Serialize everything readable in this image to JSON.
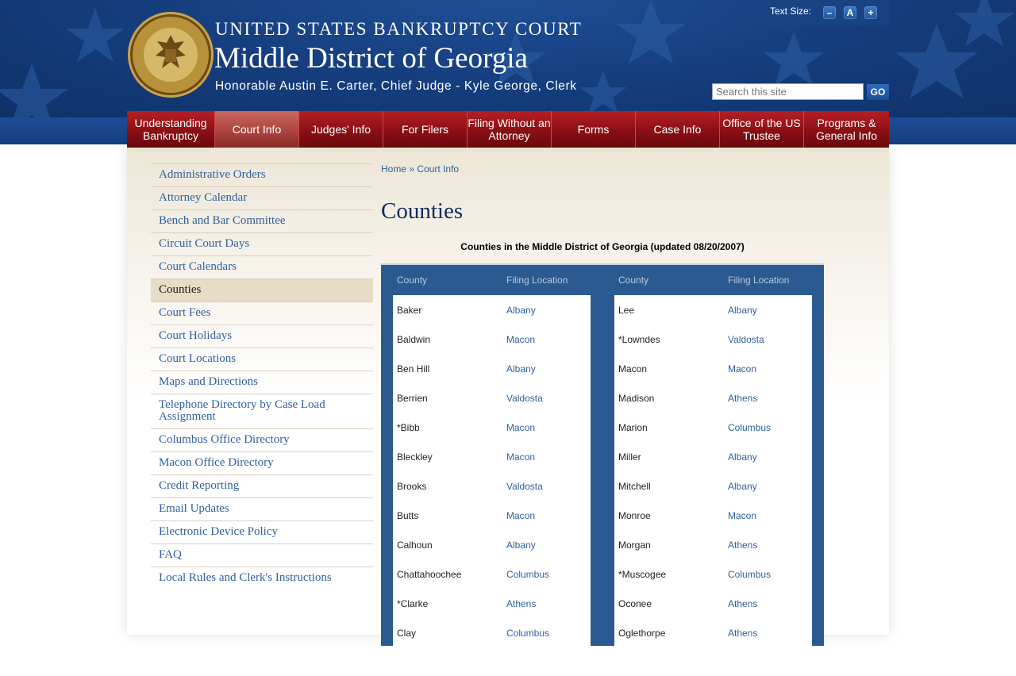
{
  "header": {
    "line1": "UNITED STATES BANKRUPTCY COURT",
    "line2": "Middle District of Georgia",
    "line3": "Honorable Austin E. Carter, Chief Judge - Kyle George, Clerk",
    "seal_text_top": "UNITED STATES BANKRUPTCY COURT",
    "seal_text_bottom": "MIDDLE DISTRICT OF GEORGIA"
  },
  "text_size": {
    "label": "Text Size:",
    "decrease": "–",
    "reset": "A",
    "increase": "+"
  },
  "search": {
    "placeholder": "Search this site",
    "go_label": "GO"
  },
  "nav": [
    {
      "label": "Understanding Bankruptcy",
      "active": false
    },
    {
      "label": "Court Info",
      "active": true
    },
    {
      "label": "Judges' Info",
      "active": false
    },
    {
      "label": "For Filers",
      "active": false
    },
    {
      "label": "Filing Without an Attorney",
      "active": false
    },
    {
      "label": "Forms",
      "active": false
    },
    {
      "label": "Case Info",
      "active": false
    },
    {
      "label": "Office of the US Trustee",
      "active": false
    },
    {
      "label": "Programs & General Info",
      "active": false
    }
  ],
  "sidebar": [
    "Administrative Orders",
    "Attorney Calendar",
    "Bench and Bar Committee",
    "Circuit Court Days",
    "Court Calendars",
    "Counties",
    "Court Fees",
    "Court Holidays",
    "Court Locations",
    "Maps and Directions",
    "Telephone Directory by Case Load Assignment",
    "Columbus Office Directory",
    "Macon Office Directory",
    "Credit Reporting",
    "Email Updates",
    "Electronic Device Policy",
    "FAQ",
    "Local Rules and Clerk's Instructions"
  ],
  "sidebar_active": "Counties",
  "breadcrumb": {
    "home": "Home",
    "sep": "»",
    "current": "Court Info"
  },
  "page_title": "Counties",
  "table_caption": "Counties in the Middle District of Georgia (updated 08/20/2007)",
  "table_headers": {
    "county": "County",
    "location": "Filing Location"
  },
  "counties_left": [
    [
      "Baker",
      "Albany"
    ],
    [
      "Baldwin",
      "Macon"
    ],
    [
      "Ben Hill",
      "Albany"
    ],
    [
      "Berrien",
      "Valdosta"
    ],
    [
      "*Bibb",
      "Macon"
    ],
    [
      "Bleckley",
      "Macon"
    ],
    [
      "Brooks",
      "Valdosta"
    ],
    [
      "Butts",
      "Macon"
    ],
    [
      "Calhoun",
      "Albany"
    ],
    [
      "Chattahoochee",
      "Columbus"
    ],
    [
      "*Clarke",
      "Athens"
    ],
    [
      "Clay",
      "Columbus"
    ]
  ],
  "counties_right": [
    [
      "Lee",
      "Albany"
    ],
    [
      "*Lowndes",
      "Valdosta"
    ],
    [
      "Macon",
      "Macon"
    ],
    [
      "Madison",
      "Athens"
    ],
    [
      "Marion",
      "Columbus"
    ],
    [
      "Miller",
      "Albany"
    ],
    [
      "Mitchell",
      "Albany"
    ],
    [
      "Monroe",
      "Macon"
    ],
    [
      "Morgan",
      "Athens"
    ],
    [
      "*Muscogee",
      "Columbus"
    ],
    [
      "Oconee",
      "Athens"
    ],
    [
      "Oglethorpe",
      "Athens"
    ]
  ]
}
